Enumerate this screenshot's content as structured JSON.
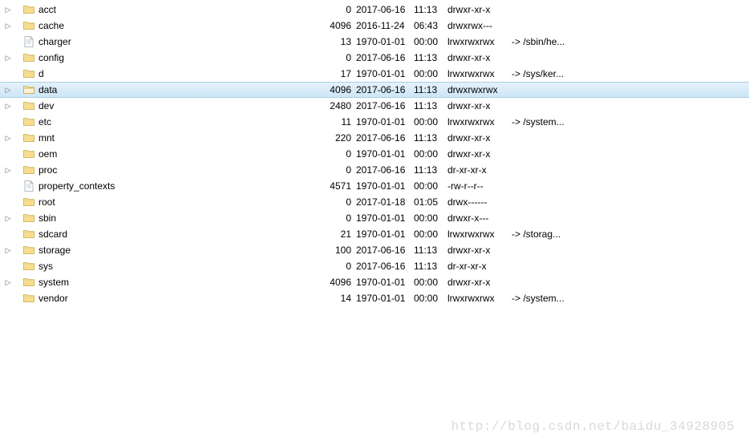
{
  "watermark": "http://blog.csdn.net/baidu_34928905",
  "rows": [
    {
      "expandable": true,
      "icon": "folder",
      "name": "acct",
      "size": "0",
      "date": "2017-06-16",
      "time": "11:13",
      "perm": "drwxr-xr-x",
      "link": "",
      "selected": false
    },
    {
      "expandable": true,
      "icon": "folder",
      "name": "cache",
      "size": "4096",
      "date": "2016-11-24",
      "time": "06:43",
      "perm": "drwxrwx---",
      "link": "",
      "selected": false
    },
    {
      "expandable": false,
      "icon": "file",
      "name": "charger",
      "size": "13",
      "date": "1970-01-01",
      "time": "00:00",
      "perm": "lrwxrwxrwx",
      "link": "-> /sbin/he...",
      "selected": false
    },
    {
      "expandable": true,
      "icon": "folder",
      "name": "config",
      "size": "0",
      "date": "2017-06-16",
      "time": "11:13",
      "perm": "drwxr-xr-x",
      "link": "",
      "selected": false
    },
    {
      "expandable": false,
      "icon": "folder",
      "name": "d",
      "size": "17",
      "date": "1970-01-01",
      "time": "00:00",
      "perm": "lrwxrwxrwx",
      "link": "-> /sys/ker...",
      "selected": false
    },
    {
      "expandable": true,
      "icon": "folder-open",
      "name": "data",
      "size": "4096",
      "date": "2017-06-16",
      "time": "11:13",
      "perm": "drwxrwxrwx",
      "link": "",
      "selected": true
    },
    {
      "expandable": true,
      "icon": "folder",
      "name": "dev",
      "size": "2480",
      "date": "2017-06-16",
      "time": "11:13",
      "perm": "drwxr-xr-x",
      "link": "",
      "selected": false
    },
    {
      "expandable": false,
      "icon": "folder",
      "name": "etc",
      "size": "11",
      "date": "1970-01-01",
      "time": "00:00",
      "perm": "lrwxrwxrwx",
      "link": "-> /system...",
      "selected": false
    },
    {
      "expandable": true,
      "icon": "folder",
      "name": "mnt",
      "size": "220",
      "date": "2017-06-16",
      "time": "11:13",
      "perm": "drwxr-xr-x",
      "link": "",
      "selected": false
    },
    {
      "expandable": false,
      "icon": "folder",
      "name": "oem",
      "size": "0",
      "date": "1970-01-01",
      "time": "00:00",
      "perm": "drwxr-xr-x",
      "link": "",
      "selected": false
    },
    {
      "expandable": true,
      "icon": "folder",
      "name": "proc",
      "size": "0",
      "date": "2017-06-16",
      "time": "11:13",
      "perm": "dr-xr-xr-x",
      "link": "",
      "selected": false
    },
    {
      "expandable": false,
      "icon": "file",
      "name": "property_contexts",
      "size": "4571",
      "date": "1970-01-01",
      "time": "00:00",
      "perm": "-rw-r--r--",
      "link": "",
      "selected": false
    },
    {
      "expandable": false,
      "icon": "folder",
      "name": "root",
      "size": "0",
      "date": "2017-01-18",
      "time": "01:05",
      "perm": "drwx------",
      "link": "",
      "selected": false
    },
    {
      "expandable": true,
      "icon": "folder",
      "name": "sbin",
      "size": "0",
      "date": "1970-01-01",
      "time": "00:00",
      "perm": "drwxr-x---",
      "link": "",
      "selected": false
    },
    {
      "expandable": false,
      "icon": "folder",
      "name": "sdcard",
      "size": "21",
      "date": "1970-01-01",
      "time": "00:00",
      "perm": "lrwxrwxrwx",
      "link": "-> /storag...",
      "selected": false
    },
    {
      "expandable": true,
      "icon": "folder",
      "name": "storage",
      "size": "100",
      "date": "2017-06-16",
      "time": "11:13",
      "perm": "drwxr-xr-x",
      "link": "",
      "selected": false
    },
    {
      "expandable": false,
      "icon": "folder",
      "name": "sys",
      "size": "0",
      "date": "2017-06-16",
      "time": "11:13",
      "perm": "dr-xr-xr-x",
      "link": "",
      "selected": false
    },
    {
      "expandable": true,
      "icon": "folder",
      "name": "system",
      "size": "4096",
      "date": "1970-01-01",
      "time": "00:00",
      "perm": "drwxr-xr-x",
      "link": "",
      "selected": false
    },
    {
      "expandable": false,
      "icon": "folder",
      "name": "vendor",
      "size": "14",
      "date": "1970-01-01",
      "time": "00:00",
      "perm": "lrwxrwxrwx",
      "link": "-> /system...",
      "selected": false
    }
  ]
}
